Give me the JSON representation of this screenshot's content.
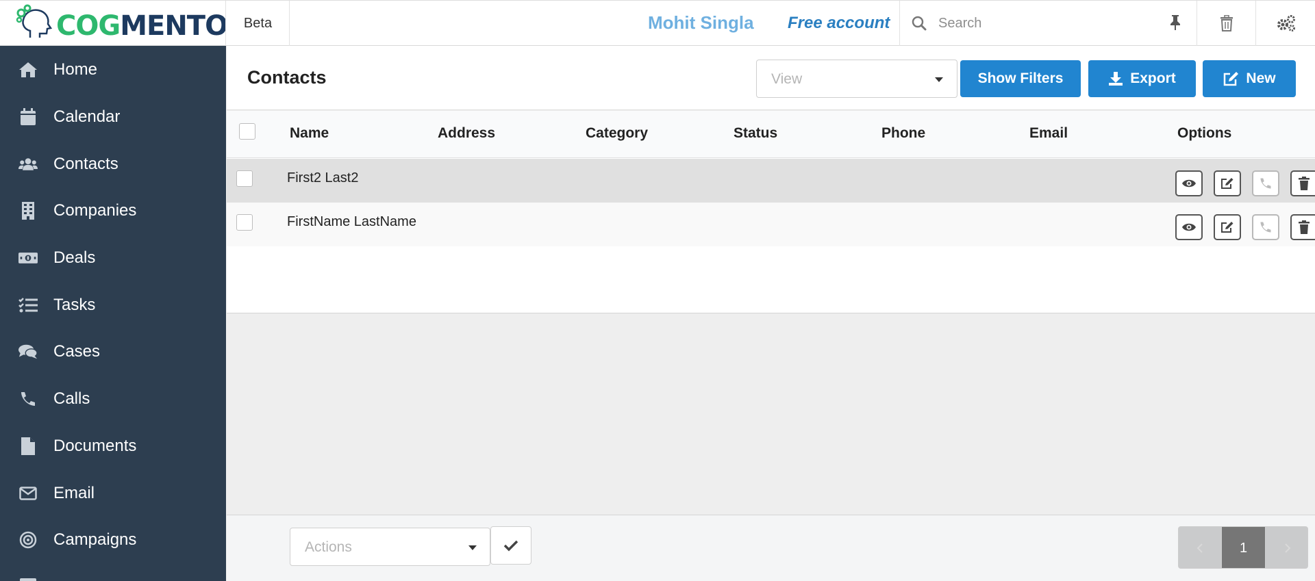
{
  "app": {
    "logo_text_a": "COG",
    "logo_text_b": "MENTO",
    "beta_label": "Beta",
    "user_name": "Mohit Singla",
    "account_type": "Free account"
  },
  "search": {
    "placeholder": "Search",
    "value": ""
  },
  "sidebar": {
    "items": [
      {
        "label": "Home",
        "icon": "home-icon"
      },
      {
        "label": "Calendar",
        "icon": "calendar-icon"
      },
      {
        "label": "Contacts",
        "icon": "users-icon"
      },
      {
        "label": "Companies",
        "icon": "building-icon"
      },
      {
        "label": "Deals",
        "icon": "money-icon"
      },
      {
        "label": "Tasks",
        "icon": "tasks-icon"
      },
      {
        "label": "Cases",
        "icon": "comments-icon"
      },
      {
        "label": "Calls",
        "icon": "phone-icon"
      },
      {
        "label": "Documents",
        "icon": "file-icon"
      },
      {
        "label": "Email",
        "icon": "envelope-icon"
      },
      {
        "label": "Campaigns",
        "icon": "bullseye-icon"
      }
    ]
  },
  "header": {
    "title": "Contacts",
    "view_placeholder": "View",
    "show_filters_label": "Show Filters",
    "export_label": "Export",
    "new_label": "New"
  },
  "table": {
    "columns": [
      "Name",
      "Address",
      "Category",
      "Status",
      "Phone",
      "Email",
      "Options"
    ],
    "rows": [
      {
        "name": "First2 Last2",
        "address": "",
        "category": "",
        "status": "",
        "phone": "",
        "email": ""
      },
      {
        "name": "FirstName LastName",
        "address": "",
        "category": "",
        "status": "",
        "phone": "",
        "email": ""
      }
    ]
  },
  "footer": {
    "actions_placeholder": "Actions",
    "current_page": "1"
  },
  "colors": {
    "sidebar_bg": "#2d3e50",
    "primary_button": "#2185d0",
    "logo_green": "#2eb86e",
    "logo_navy": "#1d3a5f",
    "user_name": "#6fb0e0",
    "account": "#2a7fc1"
  }
}
